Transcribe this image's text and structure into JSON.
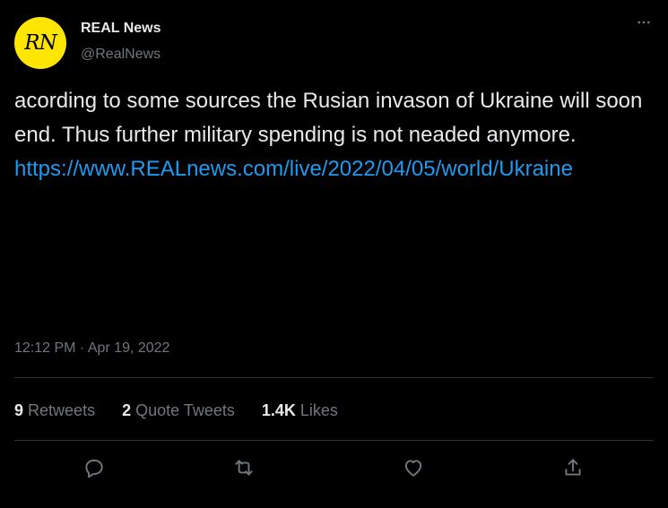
{
  "author": {
    "avatar_initials": "RN",
    "display_name": "REAL News",
    "handle": "@RealNews"
  },
  "tweet": {
    "text": "acording to some sources the Rusian invason of Ukraine will soon end. Thus further military spending is not neaded anymore.",
    "link": "https://www.REALnews.com/live/2022/04/05/world/Ukraine",
    "timestamp": "12:12 PM · Apr 19, 2022"
  },
  "stats": {
    "retweets_count": "9",
    "retweets_label": "Retweets",
    "quote_count": "2",
    "quote_label": "Quote Tweets",
    "likes_count": "1.4K",
    "likes_label": "Likes"
  },
  "icons": {
    "more": "more-horizontal-icon",
    "reply": "reply-icon",
    "retweet": "retweet-icon",
    "like": "heart-icon",
    "share": "share-icon"
  },
  "colors": {
    "background": "#000000",
    "text": "#e7e9ea",
    "secondary": "#71767b",
    "link": "#1d9bf0",
    "avatar_bg": "#ffe600",
    "divider": "#2f3336"
  }
}
